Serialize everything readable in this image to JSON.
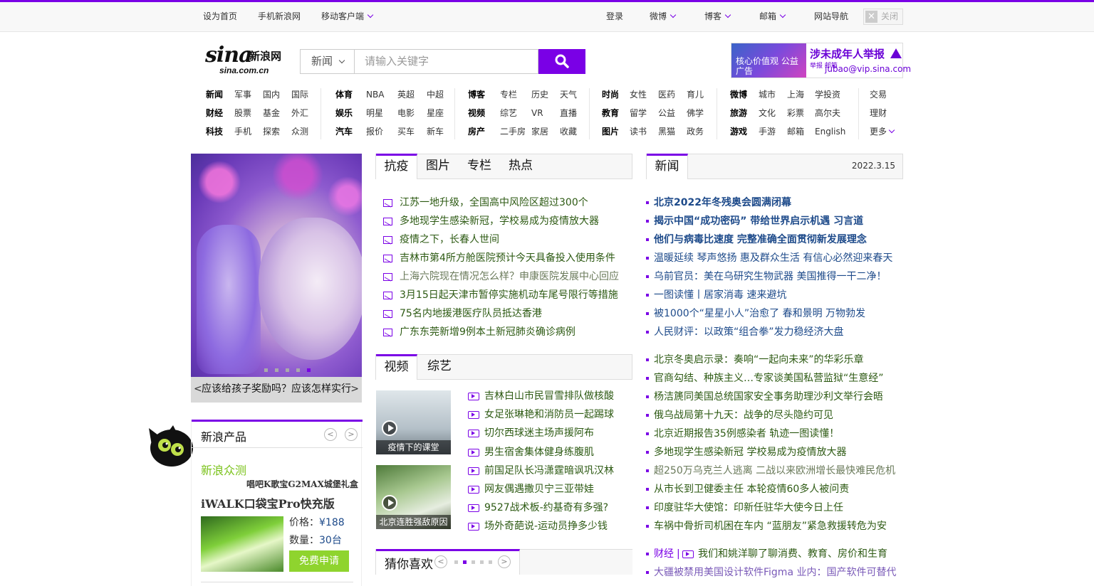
{
  "topbar": {
    "left": [
      "设为首页",
      "手机新浪网",
      "移动客户端"
    ],
    "right": [
      "登录",
      "微博",
      "博客",
      "邮箱",
      "网站导航"
    ],
    "close": "关闭"
  },
  "logo": {
    "sina": "sina",
    "cn": "新浪网",
    "domain": "sina.com.cn"
  },
  "search": {
    "select": "新闻",
    "placeholder": "请输入关键字"
  },
  "ad": {
    "left": "核心价值观 公益广告",
    "title": "涉未成年人举报",
    "small": "举报 邮箱",
    "email": "jubao@vip.sina.com"
  },
  "nav": {
    "g1": [
      [
        "新闻",
        "军事",
        "国内",
        "国际"
      ],
      [
        "财经",
        "股票",
        "基金",
        "外汇"
      ],
      [
        "科技",
        "手机",
        "探索",
        "众测"
      ]
    ],
    "g2": [
      [
        "体育",
        "NBA",
        "英超",
        "中超"
      ],
      [
        "娱乐",
        "明星",
        "电影",
        "星座"
      ],
      [
        "汽车",
        "报价",
        "买车",
        "新车"
      ]
    ],
    "g3": [
      [
        "博客",
        "专栏",
        "历史",
        "天气"
      ],
      [
        "视频",
        "综艺",
        "VR",
        "直播"
      ],
      [
        "房产",
        "二手房",
        "家居",
        "收藏"
      ]
    ],
    "g4": [
      [
        "时尚",
        "女性",
        "医药",
        "育儿"
      ],
      [
        "教育",
        "留学",
        "公益",
        "佛学"
      ],
      [
        "图片",
        "读书",
        "黑猫",
        "政务"
      ]
    ],
    "g5": [
      [
        "微博",
        "城市",
        "上海",
        "学投资"
      ],
      [
        "旅游",
        "文化",
        "彩票",
        "高尔夫"
      ],
      [
        "游戏",
        "手游",
        "邮箱",
        "English"
      ]
    ],
    "g6": [
      "交易",
      "理财",
      "更多"
    ]
  },
  "slider": {
    "caption": "应该给孩子奖励吗？应该怎样实行"
  },
  "tabs1": [
    "抗疫",
    "图片",
    "专栏",
    "热点"
  ],
  "list1": [
    "江苏一地升级，全国高中风险区超过300个",
    "多地现学生感染新冠，学校易成为疫情放大器",
    "疫情之下，长春人世间",
    "吉林市第4所方舱医院预计今天具备投入使用条件",
    "上海六院现在情况怎么样？申康医院发展中心回应",
    "3月15日起天津市暂停实施机动车尾号限行等措施",
    "75名内地援港医疗队员抵达香港",
    "广东东莞新增9例本土新冠肺炎确诊病例"
  ],
  "tabs2": [
    "视频",
    "综艺"
  ],
  "thumbs": [
    "疫情下的课堂",
    "北京连胜强敌原因"
  ],
  "list2": [
    "吉林白山市民冒雪排队做核酸",
    "女足张琳艳和消防员一起踢球",
    "切尔西球迷主场声援阿布",
    "男生宿舍集体健身练腹肌",
    "前国足队长冯潇霆暗讽巩汉林",
    "网友偶遇撒贝宁三亚带娃",
    "9527战术板-约基奇有多强?",
    "场外奇葩说-运动员挣多少钱"
  ],
  "guess": {
    "title": "猜你喜欢"
  },
  "news": {
    "tab": "新闻",
    "date": "2022.3.15"
  },
  "list3a": [
    "北京2022年冬残奥会圆满闭幕",
    "揭示中国“成功密码” 带给世界启示机遇 习言道",
    "他们与病毒比速度 完整准确全面贯彻新发展理念"
  ],
  "list3b": [
    "温暖延续 琴声悠扬 惠及群众生活 有信心必然迎来春天",
    "乌前官员：美在乌研究生物武器 美国推得一干二净！",
    "一图读懂丨居家消毒 速来避坑",
    "被1000个“星星小人”治愈了 春和景明 万物勃发",
    "人民财评：以政策“组合拳”发力稳经济大盘"
  ],
  "list4": [
    "北京冬奥启示录：奏响“一起向未来”的华彩乐章",
    "官商勾结、种族主义…专家谈美国私营监狱“生意经”",
    "杨洁篪同美国总统国家安全事务助理沙利文举行会晤",
    "俄乌战局第十九天：战争的尽头隐约可见",
    "北京近期报告35例感染者 轨迹一图读懂！",
    "多地现学生感染新冠 学校易成为疫情放大器",
    "超250万乌克兰人逃离 二战以来欧洲增长最快难民危机",
    "从市长到卫健委主任 本轮疫情60多人被问责",
    "印度驻华大使馆：印新任驻华大使今日上任",
    "车祸中骨折司机困在车内 “蓝朋友”紧急救援转危为安"
  ],
  "finance": {
    "label": "财经",
    "sep": "|",
    "title": "我们和姚洋聊了聊消费、教育、房价和生育"
  },
  "last": "大疆被禁用美国设计软件Figma 业内：国产软件可替代",
  "product": {
    "title": "新浪产品",
    "brand": "新浪众测",
    "sub": "唱吧K歌宝G2MAX城堡礼盒",
    "name": "iWALK口袋宝Pro快充版",
    "price_label": "价格：",
    "price": "¥188",
    "qty_label": "数量：",
    "qty": "30台",
    "apply": "免费申请"
  }
}
